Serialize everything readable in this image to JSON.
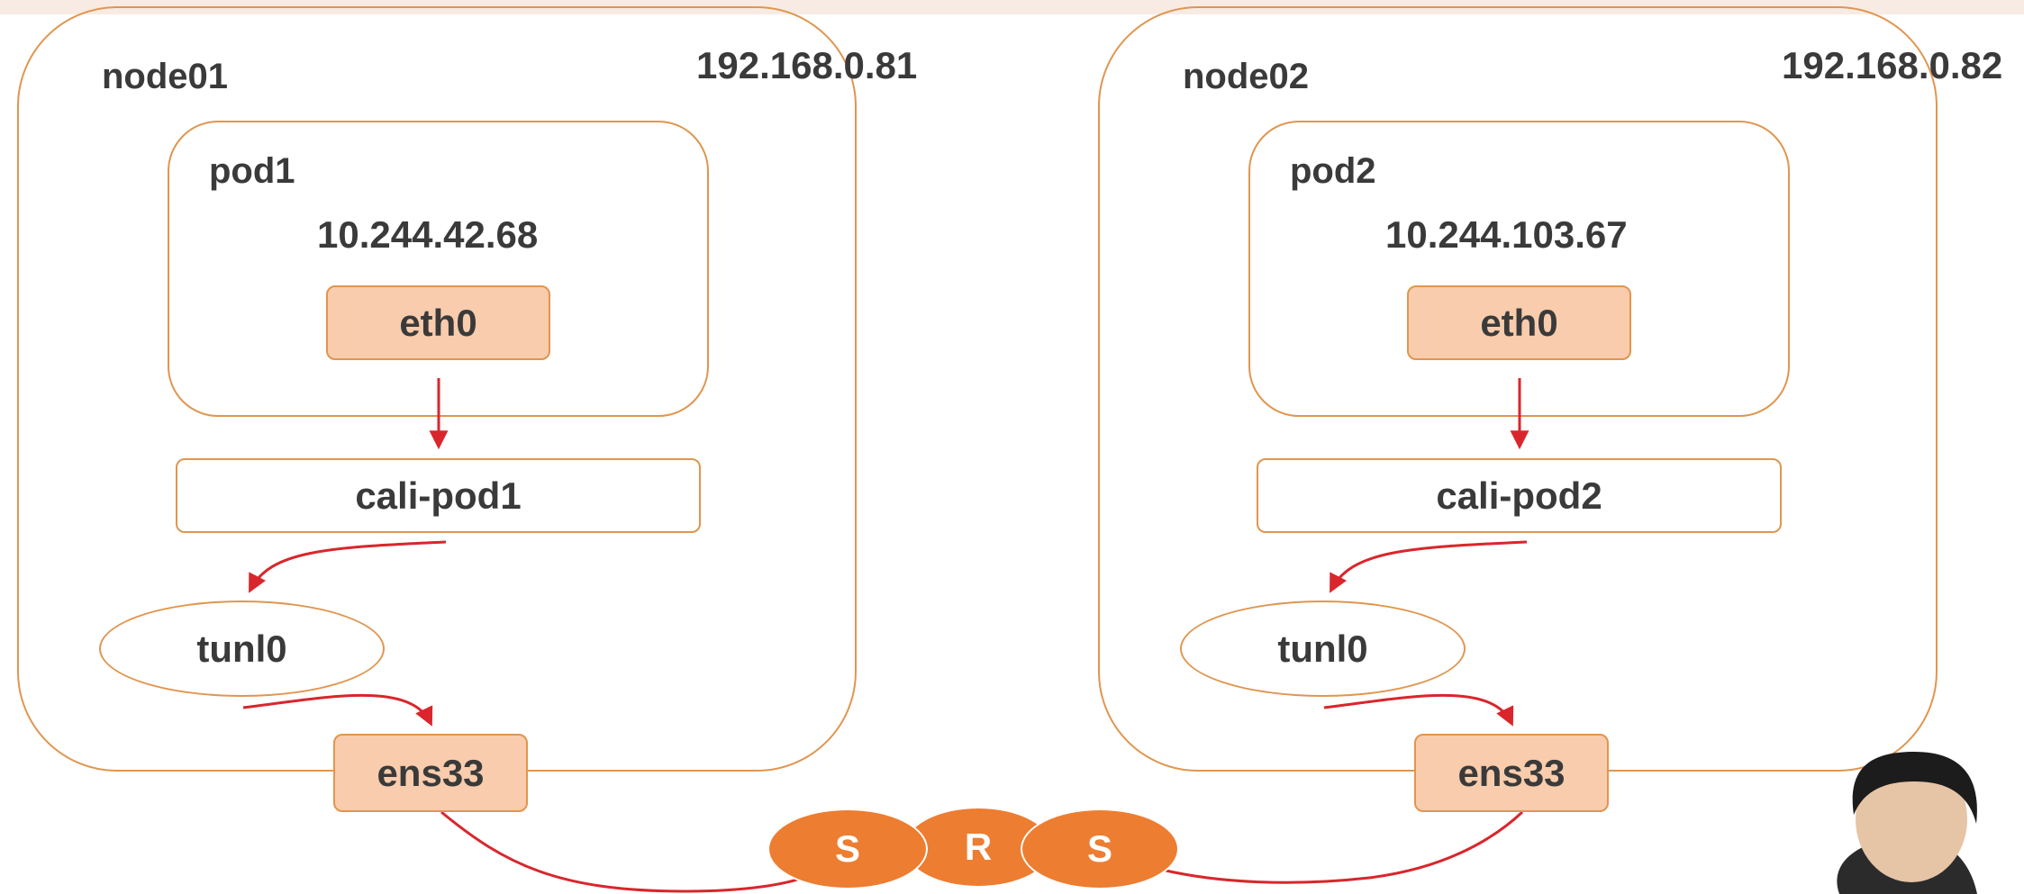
{
  "nodes": [
    {
      "name": "node01",
      "ip": "192.168.0.81",
      "pod": {
        "name": "pod1",
        "ip": "10.244.42.68",
        "iface": "eth0"
      },
      "veth": "cali-pod1",
      "tunnel": "tunl0",
      "nic": "ens33"
    },
    {
      "name": "node02",
      "ip": "192.168.0.82",
      "pod": {
        "name": "pod2",
        "ip": "10.244.103.67",
        "iface": "eth0"
      },
      "veth": "cali-pod2",
      "tunnel": "tunl0",
      "nic": "ens33"
    }
  ],
  "network": {
    "left": "S",
    "middle": "R",
    "right": "S"
  },
  "colors": {
    "border": "#e0964f",
    "fill": "#f8ccac",
    "arrow": "#d9262c",
    "oval": "#ed7d31",
    "text": "#3a3a3a"
  }
}
